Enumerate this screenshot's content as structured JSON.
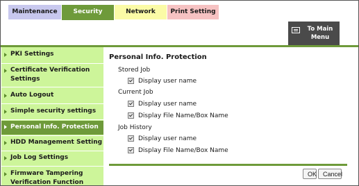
{
  "tabs": {
    "maintenance": "Maintenance",
    "security": "Security",
    "network": "Network",
    "print_setting": "Print Setting"
  },
  "header": {
    "to_main_menu_line1": "To Main",
    "to_main_menu_line2": "Menu"
  },
  "sidebar": {
    "items": [
      {
        "label": "PKI Settings"
      },
      {
        "label_line1": "Certificate Verification",
        "label_line2": "Settings"
      },
      {
        "label": "Auto Logout"
      },
      {
        "label": "Simple security settings"
      },
      {
        "label": "Personal Info. Protection"
      },
      {
        "label": "HDD Management Setting"
      },
      {
        "label": "Job Log Settings"
      },
      {
        "label_line1": "Firmware Tampering",
        "label_line2": "Verification Function"
      }
    ]
  },
  "main": {
    "title": "Personal Info. Protection",
    "groups": [
      {
        "label": "Stored Job",
        "options": [
          {
            "label": "Display user name",
            "checked": true
          }
        ]
      },
      {
        "label": "Current Job",
        "options": [
          {
            "label": "Display user name",
            "checked": true
          },
          {
            "label": "Display File Name/Box Name",
            "checked": true
          }
        ]
      },
      {
        "label": "Job History",
        "options": [
          {
            "label": "Display user name",
            "checked": true
          },
          {
            "label": "Display File Name/Box Name",
            "checked": true
          }
        ]
      }
    ]
  },
  "buttons": {
    "ok": "OK",
    "cancel": "Cancel"
  },
  "colors": {
    "accent_green": "#6e9a3a",
    "sidebar_bg": "#cdf59a",
    "tab_maintenance": "#c8c8ee",
    "tab_network": "#fbfba6",
    "tab_print_setting": "#f6c2c2"
  },
  "icons": {
    "to_main_menu": "menu-list-icon",
    "sidebar_bullet": "triangle-right-icon",
    "checkbox": "checkmark-icon"
  }
}
